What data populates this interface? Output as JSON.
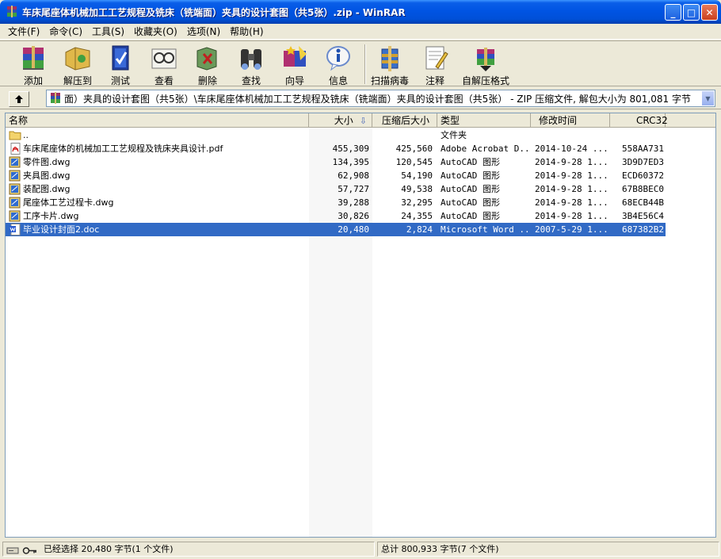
{
  "window": {
    "title": "车床尾座体机械加工工艺规程及铣床（铣端面）夹具的设计套图（共5张）.zip - WinRAR",
    "buttons": {
      "minimize": "_",
      "maximize": "□",
      "close": "✕"
    }
  },
  "menu": [
    "文件(F)",
    "命令(C)",
    "工具(S)",
    "收藏夹(O)",
    "选项(N)",
    "帮助(H)"
  ],
  "toolbar": [
    {
      "label": "添加",
      "icon": "add-archive-icon"
    },
    {
      "label": "解压到",
      "icon": "extract-to-icon"
    },
    {
      "label": "测试",
      "icon": "test-icon"
    },
    {
      "label": "查看",
      "icon": "view-icon"
    },
    {
      "label": "删除",
      "icon": "delete-icon"
    },
    {
      "label": "查找",
      "icon": "find-icon"
    },
    {
      "label": "向导",
      "icon": "wizard-icon"
    },
    {
      "label": "信息",
      "icon": "info-icon"
    },
    {
      "label": "扫描病毒",
      "icon": "virus-scan-icon"
    },
    {
      "label": "注释",
      "icon": "comment-icon"
    },
    {
      "label": "自解压格式",
      "icon": "sfx-icon"
    }
  ],
  "address": {
    "path": "面）夹具的设计套图（共5张）\\车床尾座体机械加工工艺规程及铣床（铣端面）夹具的设计套图（共5张） - ZIP 压缩文件, 解包大小为 801,081 字节"
  },
  "columns": {
    "name": "名称",
    "size": "大小",
    "packed": "压缩后大小",
    "type": "类型",
    "modified": "修改时间",
    "crc": "CRC32"
  },
  "files": [
    {
      "name": "..",
      "size": "",
      "packed": "",
      "type": "文件夹",
      "modified": "",
      "crc": "",
      "icon": "folder-icon",
      "selected": false
    },
    {
      "name": "车床尾座体的机械加工工艺规程及铣床夹具设计.pdf",
      "size": "455,309",
      "packed": "425,560",
      "type": "Adobe Acrobat D...",
      "modified": "2014-10-24 ...",
      "crc": "558AA731",
      "icon": "pdf-icon",
      "selected": false
    },
    {
      "name": "零件图.dwg",
      "size": "134,395",
      "packed": "120,545",
      "type": "AutoCAD 图形",
      "modified": "2014-9-28 1...",
      "crc": "3D9D7ED3",
      "icon": "dwg-icon",
      "selected": false
    },
    {
      "name": "夹具图.dwg",
      "size": "62,908",
      "packed": "54,190",
      "type": "AutoCAD 图形",
      "modified": "2014-9-28 1...",
      "crc": "ECD60372",
      "icon": "dwg-icon",
      "selected": false
    },
    {
      "name": "装配图.dwg",
      "size": "57,727",
      "packed": "49,538",
      "type": "AutoCAD 图形",
      "modified": "2014-9-28 1...",
      "crc": "67B8BEC0",
      "icon": "dwg-icon",
      "selected": false
    },
    {
      "name": "尾座体工艺过程卡.dwg",
      "size": "39,288",
      "packed": "32,295",
      "type": "AutoCAD 图形",
      "modified": "2014-9-28 1...",
      "crc": "68ECB44B",
      "icon": "dwg-icon",
      "selected": false
    },
    {
      "name": "工序卡片.dwg",
      "size": "30,826",
      "packed": "24,355",
      "type": "AutoCAD 图形",
      "modified": "2014-9-28 1...",
      "crc": "3B4E56C4",
      "icon": "dwg-icon",
      "selected": false
    },
    {
      "name": "毕业设计封面2.doc",
      "size": "20,480",
      "packed": "2,824",
      "type": "Microsoft Word ...",
      "modified": "2007-5-29 1...",
      "crc": "687382B2",
      "icon": "doc-icon",
      "selected": true
    }
  ],
  "status": {
    "left": "已经选择 20,480 字节(1 个文件)",
    "right": "总计 800,933 字节(7 个文件)"
  },
  "colors": {
    "title_bar": "#0054e3",
    "selection": "#316ac5",
    "chrome": "#ece9d8"
  }
}
